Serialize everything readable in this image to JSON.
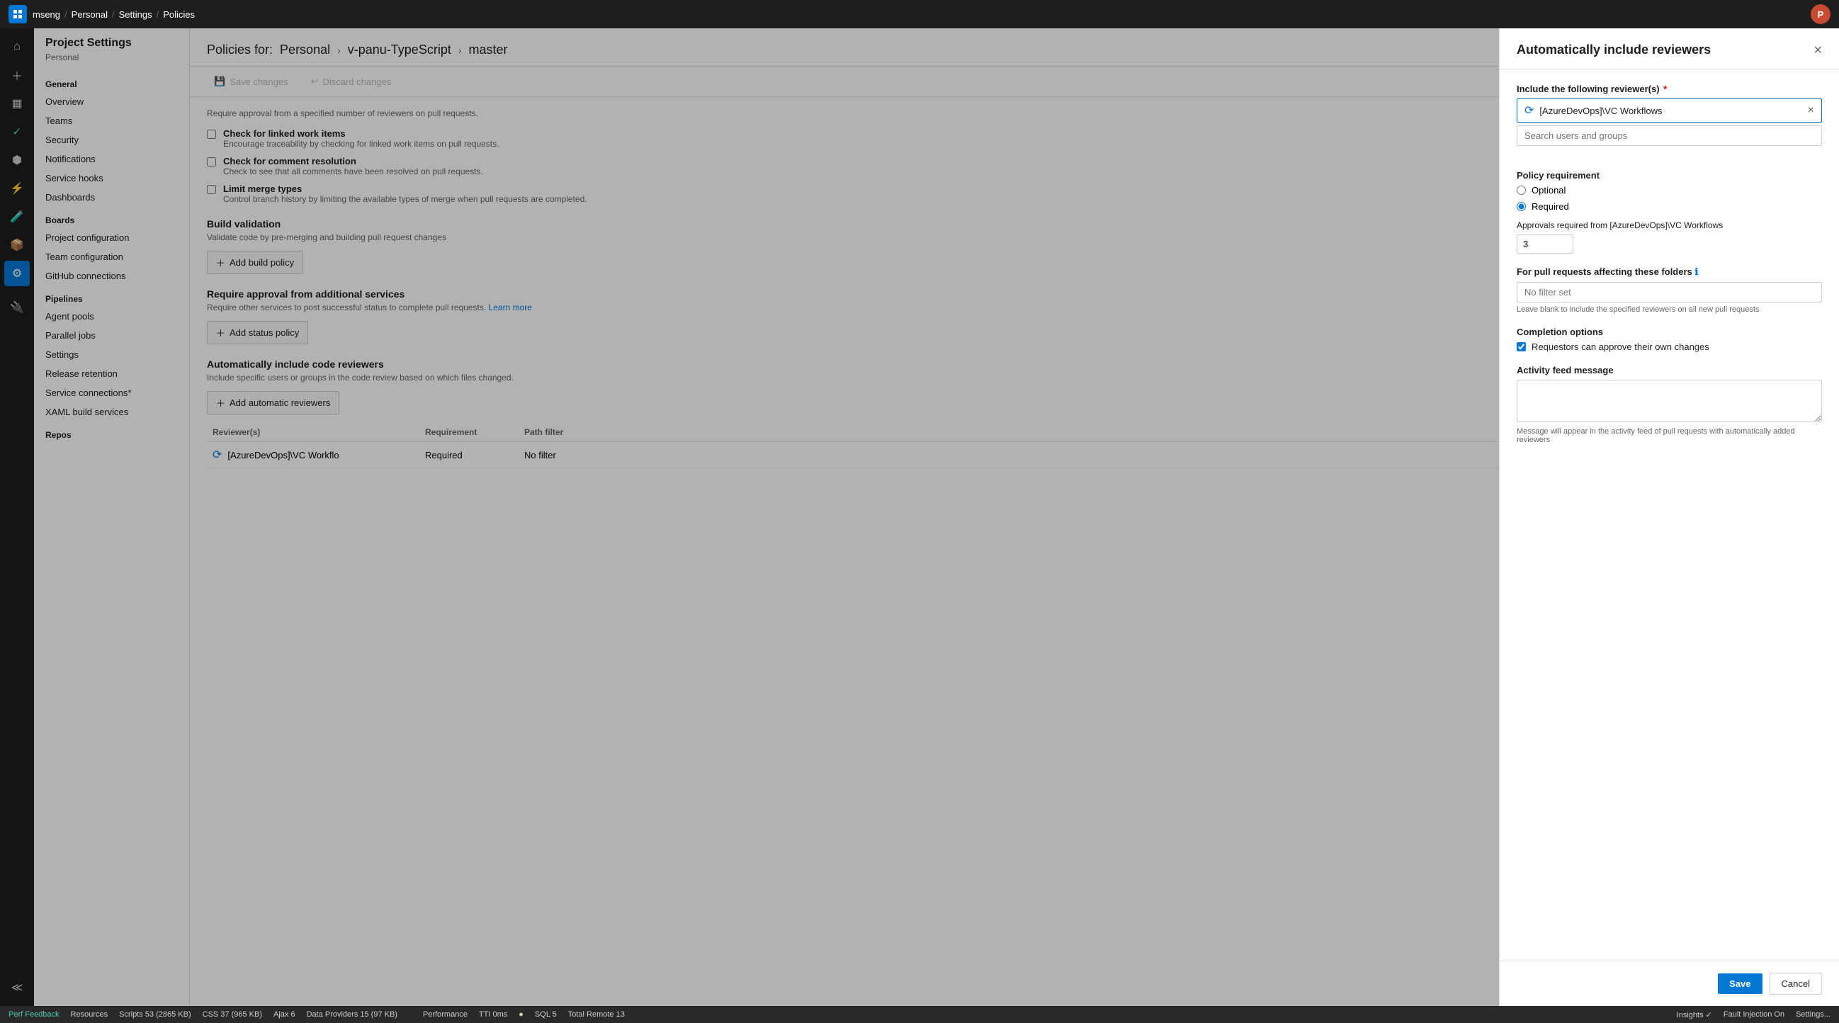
{
  "topbar": {
    "breadcrumb": [
      "mseng",
      "Personal",
      "Settings",
      "Policies"
    ]
  },
  "sidebar": {
    "title": "Project Settings",
    "subtitle": "Personal",
    "general_label": "General",
    "items_general": [
      {
        "label": "Overview",
        "active": false
      },
      {
        "label": "Teams",
        "active": false
      },
      {
        "label": "Security",
        "active": false
      },
      {
        "label": "Notifications",
        "active": false
      },
      {
        "label": "Service hooks",
        "active": false
      },
      {
        "label": "Dashboards",
        "active": false
      }
    ],
    "boards_label": "Boards",
    "items_boards": [
      {
        "label": "Project configuration",
        "active": false
      },
      {
        "label": "Team configuration",
        "active": false
      },
      {
        "label": "GitHub connections",
        "active": false
      }
    ],
    "pipelines_label": "Pipelines",
    "items_pipelines": [
      {
        "label": "Agent pools",
        "active": false
      },
      {
        "label": "Parallel jobs",
        "active": false
      },
      {
        "label": "Settings",
        "active": false
      },
      {
        "label": "Release retention",
        "active": false
      },
      {
        "label": "Service connections*",
        "active": false
      },
      {
        "label": "XAML build services",
        "active": false
      }
    ],
    "repos_label": "Repos"
  },
  "content": {
    "title_prefix": "Policies for:",
    "path1": "Personal",
    "path2": "v-panu-TypeScript",
    "path3": "master",
    "toolbar": {
      "save_label": "Save changes",
      "discard_label": "Discard changes"
    },
    "checks_header": "Require approval from a specified number of reviewers on pull requests.",
    "checks": [
      {
        "label": "Check for linked work items",
        "desc": "Encourage traceability by checking for linked work items on pull requests."
      },
      {
        "label": "Check for comment resolution",
        "desc": "Check to see that all comments have been resolved on pull requests."
      },
      {
        "label": "Limit merge types",
        "desc": "Control branch history by limiting the available types of merge when pull requests are completed."
      }
    ],
    "build_validation_title": "Build validation",
    "build_validation_desc": "Validate code by pre-merging and building pull request changes",
    "add_build_policy": "Add build policy",
    "status_section_title": "Require approval from additional services",
    "status_section_desc": "Require other services to post successful status to complete pull requests.",
    "learn_more_label": "Learn more",
    "add_status_policy": "Add status policy",
    "reviewers_section_title": "Automatically include code reviewers",
    "reviewers_section_desc": "Include specific users or groups in the code review based on which files changed.",
    "add_automatic_reviewers": "Add automatic reviewers",
    "table_headers": [
      "Reviewer(s)",
      "Requirement",
      "Path filter"
    ],
    "table_rows": [
      {
        "reviewer": "[AzureDevOps]\\VC Workflo",
        "requirement": "Required",
        "path_filter": "No filter"
      }
    ]
  },
  "modal": {
    "title": "Automatically include reviewers",
    "close_label": "×",
    "reviewer_label": "Include the following reviewer(s)",
    "reviewer_tag": "[AzureDevOps]\\VC Workflows",
    "search_placeholder": "Search users and groups",
    "policy_requirement_label": "Policy requirement",
    "options": [
      {
        "label": "Optional",
        "checked": false
      },
      {
        "label": "Required",
        "checked": true
      }
    ],
    "approvals_label": "Approvals required from [AzureDevOps]\\VC Workflows",
    "approvals_value": "3",
    "folders_label": "For pull requests affecting these folders",
    "folders_placeholder": "No filter set",
    "folders_hint": "Leave blank to include the specified reviewers on all new pull requests",
    "completion_label": "Completion options",
    "completion_checkbox": "Requestors can approve their own changes",
    "activity_label": "Activity feed message",
    "activity_hint": "Message will appear in the activity feed of pull requests with automatically added reviewers",
    "save_label": "Save",
    "cancel_label": "Cancel"
  },
  "statusbar": {
    "perf": "Perf Feedback",
    "resources": "Resources",
    "scripts": "Scripts 53 (2865 KB)",
    "css": "CSS 37 (965 KB)",
    "ajax": "Ajax 6",
    "data_providers": "Data Providers 15 (97 KB)",
    "performance": "Performance",
    "tti": "TTI 0ms",
    "sql": "SQL 5",
    "total_remote": "Total Remote 13",
    "insights": "Insights ✓",
    "fault_injection": "Fault Injection On",
    "settings": "Settings..."
  }
}
